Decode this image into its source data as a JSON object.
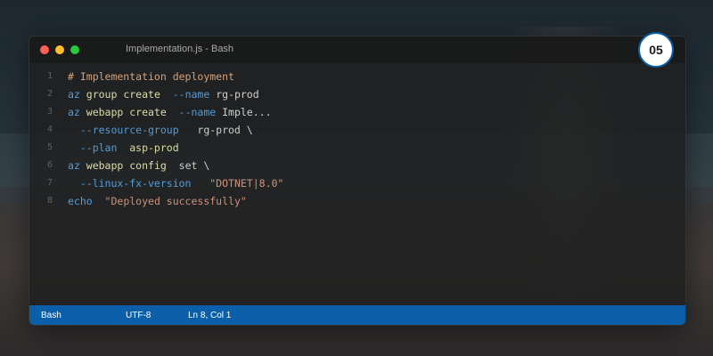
{
  "window": {
    "title": "Implementation.js - Bash"
  },
  "badge": {
    "number": "05"
  },
  "code_lines": [
    {
      "n": "1",
      "tokens": [
        {
          "t": "# Implementation deployment",
          "k": "comment"
        }
      ]
    },
    {
      "n": "2",
      "tokens": [
        {
          "t": "az",
          "k": "cmd"
        },
        {
          "t": " group create",
          "k": "sub"
        },
        {
          "t": "  --name",
          "k": "flag"
        },
        {
          "t": " rg-prod",
          "k": "val"
        }
      ]
    },
    {
      "n": "3",
      "tokens": [
        {
          "t": "az",
          "k": "cmd"
        },
        {
          "t": " webapp create",
          "k": "sub"
        },
        {
          "t": "  --name",
          "k": "flag"
        },
        {
          "t": " Imple...",
          "k": "val"
        }
      ]
    },
    {
      "n": "4",
      "tokens": [
        {
          "t": "  --resource-group",
          "k": "flag"
        },
        {
          "t": "   rg-prod \\",
          "k": "val"
        }
      ]
    },
    {
      "n": "5",
      "tokens": [
        {
          "t": "  --plan",
          "k": "flag"
        },
        {
          "t": "  asp-prod",
          "k": "sub"
        }
      ]
    },
    {
      "n": "6",
      "tokens": [
        {
          "t": "az",
          "k": "cmd"
        },
        {
          "t": " webapp config",
          "k": "sub"
        },
        {
          "t": "  set \\",
          "k": "val"
        }
      ]
    },
    {
      "n": "7",
      "tokens": [
        {
          "t": "  --linux-fx-version",
          "k": "flag"
        },
        {
          "t": "   \"DOTNET|8.0\"",
          "k": "str"
        }
      ]
    },
    {
      "n": "8",
      "tokens": [
        {
          "t": "echo",
          "k": "cmd"
        },
        {
          "t": "  \"Deployed successfully\"",
          "k": "str"
        }
      ]
    }
  ],
  "statusbar": {
    "language": "Bash",
    "encoding": "UTF-8",
    "position": "Ln 8, Col 1"
  },
  "colors": {
    "statusbar": "#0b5fa8",
    "close": "#ff5f56",
    "minimize": "#ffbd2e",
    "maximize": "#27c93f"
  }
}
